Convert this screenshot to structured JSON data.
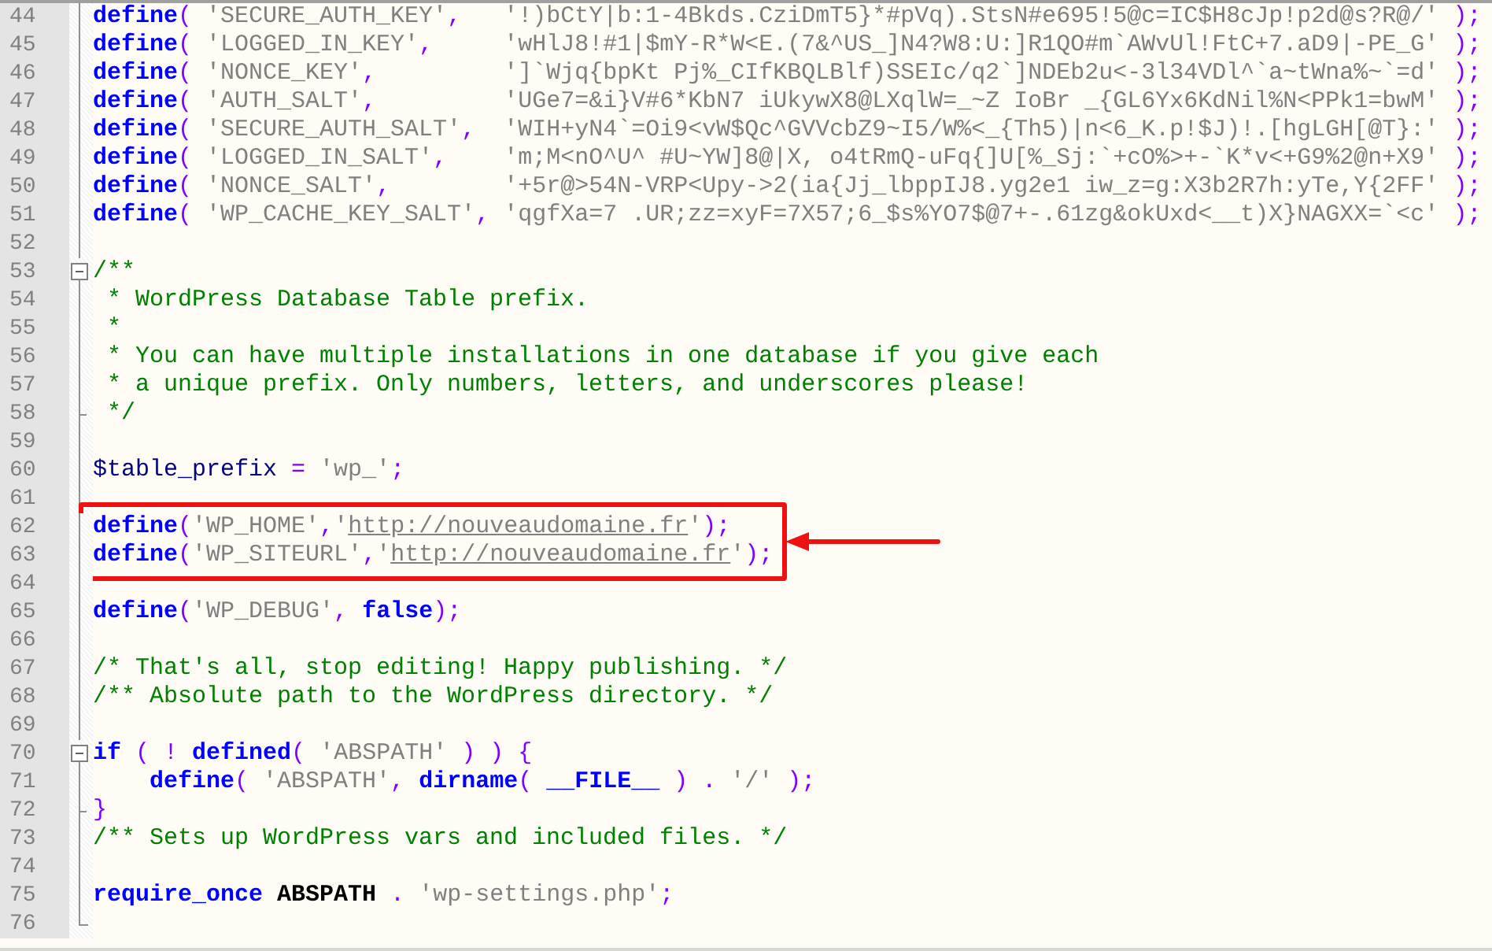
{
  "editor": {
    "lines": [
      {
        "number": "44",
        "kind": "line",
        "boxed": false,
        "tokens": [
          {
            "kind": "keyword",
            "text": "define"
          },
          {
            "kind": "operator",
            "text": "( "
          },
          {
            "kind": "string",
            "text": "'SECURE_AUTH_KEY'"
          },
          {
            "kind": "operator",
            "text": ",   "
          },
          {
            "kind": "string",
            "text": "'!)bCtY|b:1-4Bkds.CziDmT5}*#pVq).StsN#e695!5@c=IC$H8cJp!p2d@s?R@/'"
          },
          {
            "kind": "operator",
            "text": " );"
          }
        ]
      },
      {
        "number": "45",
        "kind": "line",
        "boxed": false,
        "tokens": [
          {
            "kind": "keyword",
            "text": "define"
          },
          {
            "kind": "operator",
            "text": "( "
          },
          {
            "kind": "string",
            "text": "'LOGGED_IN_KEY'"
          },
          {
            "kind": "operator",
            "text": ",     "
          },
          {
            "kind": "string",
            "text": "'wHlJ8!#1|$mY-R*W<E.(7&^US_]N4?W8:U:]R1QO#m`AWvUl!FtC+7.aD9|-PE_G'"
          },
          {
            "kind": "operator",
            "text": " );"
          }
        ]
      },
      {
        "number": "46",
        "kind": "line",
        "boxed": false,
        "tokens": [
          {
            "kind": "keyword",
            "text": "define"
          },
          {
            "kind": "operator",
            "text": "( "
          },
          {
            "kind": "string",
            "text": "'NONCE_KEY'"
          },
          {
            "kind": "operator",
            "text": ",         "
          },
          {
            "kind": "string",
            "text": "']`Wjq{bpKt Pj%_CIfKBQLBlf)SSEIc/q2`]NDEb2u<-3l34VDl^`a~tWna%~`=d'"
          },
          {
            "kind": "operator",
            "text": " );"
          }
        ]
      },
      {
        "number": "47",
        "kind": "line",
        "boxed": false,
        "tokens": [
          {
            "kind": "keyword",
            "text": "define"
          },
          {
            "kind": "operator",
            "text": "( "
          },
          {
            "kind": "string",
            "text": "'AUTH_SALT'"
          },
          {
            "kind": "operator",
            "text": ",         "
          },
          {
            "kind": "string",
            "text": "'UGe7=&i}V#6*KbN7 iUkywX8@LXqlW=_~Z IoBr _{GL6Yx6KdNil%N<PPk1=bwM'"
          },
          {
            "kind": "operator",
            "text": " );"
          }
        ]
      },
      {
        "number": "48",
        "kind": "line",
        "boxed": false,
        "tokens": [
          {
            "kind": "keyword",
            "text": "define"
          },
          {
            "kind": "operator",
            "text": "( "
          },
          {
            "kind": "string",
            "text": "'SECURE_AUTH_SALT'"
          },
          {
            "kind": "operator",
            "text": ",  "
          },
          {
            "kind": "string",
            "text": "'WIH+yN4`=Oi9<vW$Qc^GVVcbZ9~I5/W%<_{Th5)|n<6_K.p!$J)!.[hgLGH[@T}:'"
          },
          {
            "kind": "operator",
            "text": " );"
          }
        ]
      },
      {
        "number": "49",
        "kind": "line",
        "boxed": false,
        "tokens": [
          {
            "kind": "keyword",
            "text": "define"
          },
          {
            "kind": "operator",
            "text": "( "
          },
          {
            "kind": "string",
            "text": "'LOGGED_IN_SALT'"
          },
          {
            "kind": "operator",
            "text": ",    "
          },
          {
            "kind": "string",
            "text": "'m;M<nO^U^ #U~YW]8@|X, o4tRmQ-uFq{]U[%_Sj:`+cO%>+-`K*v<+G9%2@n+X9'"
          },
          {
            "kind": "operator",
            "text": " );"
          }
        ]
      },
      {
        "number": "50",
        "kind": "line",
        "boxed": false,
        "tokens": [
          {
            "kind": "keyword",
            "text": "define"
          },
          {
            "kind": "operator",
            "text": "( "
          },
          {
            "kind": "string",
            "text": "'NONCE_SALT'"
          },
          {
            "kind": "operator",
            "text": ",        "
          },
          {
            "kind": "string",
            "text": "'+5r@>54N-VRP<Upy->2(ia{Jj_lbppIJ8.yg2e1 iw_z=g:X3b2R7h:yTe,Y{2FF'"
          },
          {
            "kind": "operator",
            "text": " );"
          }
        ]
      },
      {
        "number": "51",
        "kind": "line",
        "boxed": false,
        "tokens": [
          {
            "kind": "keyword",
            "text": "define"
          },
          {
            "kind": "operator",
            "text": "( "
          },
          {
            "kind": "string",
            "text": "'WP_CACHE_KEY_SALT'"
          },
          {
            "kind": "operator",
            "text": ", "
          },
          {
            "kind": "string",
            "text": "'qgfXa=7 .UR;zz=xyF=7X57;6_$s%YO7$@7+-.61zg&okUxd<__t)X}NAGXX=`<c'"
          },
          {
            "kind": "operator",
            "text": " );"
          }
        ]
      },
      {
        "number": "52",
        "kind": "line",
        "boxed": false
      },
      {
        "number": "53",
        "kind": "open",
        "boxed": false,
        "tokens": [
          {
            "kind": "comment",
            "text": "/**"
          }
        ]
      },
      {
        "number": "54",
        "kind": "line",
        "boxed": false,
        "tokens": [
          {
            "kind": "comment",
            "text": " * WordPress Database Table prefix."
          }
        ]
      },
      {
        "number": "55",
        "kind": "line",
        "boxed": false,
        "tokens": [
          {
            "kind": "comment",
            "text": " *"
          }
        ]
      },
      {
        "number": "56",
        "kind": "line",
        "boxed": false,
        "tokens": [
          {
            "kind": "comment",
            "text": " * You can have multiple installations in one database if you give each"
          }
        ]
      },
      {
        "number": "57",
        "kind": "line",
        "boxed": false,
        "tokens": [
          {
            "kind": "comment",
            "text": " * a unique prefix. Only numbers, letters, and underscores please!"
          }
        ]
      },
      {
        "number": "58",
        "kind": "end",
        "boxed": false,
        "tokens": [
          {
            "kind": "comment",
            "text": " */"
          }
        ]
      },
      {
        "number": "59",
        "kind": "line",
        "boxed": false
      },
      {
        "number": "60",
        "kind": "line",
        "boxed": false,
        "tokens": [
          {
            "kind": "variable",
            "text": "$table_prefix"
          },
          {
            "kind": "operator",
            "text": " = "
          },
          {
            "kind": "string",
            "text": "'wp_'"
          },
          {
            "kind": "operator",
            "text": ";"
          }
        ]
      },
      {
        "number": "61",
        "kind": "line",
        "boxed": false
      },
      {
        "number": "62",
        "kind": "line",
        "boxed": true,
        "tokens": [
          {
            "kind": "keyword",
            "text": "define"
          },
          {
            "kind": "operator",
            "text": "("
          },
          {
            "kind": "string",
            "text": "'WP_HOME'"
          },
          {
            "kind": "operator",
            "text": ","
          },
          {
            "kind": "string",
            "text": "'"
          },
          {
            "kind": "link",
            "text": "http://nouveaudomaine.fr"
          },
          {
            "kind": "string",
            "text": "'"
          },
          {
            "kind": "operator",
            "text": ");"
          }
        ]
      },
      {
        "number": "63",
        "kind": "line",
        "boxed": true,
        "tokens": [
          {
            "kind": "keyword",
            "text": "define"
          },
          {
            "kind": "operator",
            "text": "("
          },
          {
            "kind": "string",
            "text": "'WP_SITEURL'"
          },
          {
            "kind": "operator",
            "text": ","
          },
          {
            "kind": "string",
            "text": "'"
          },
          {
            "kind": "link",
            "text": "http://nouveaudomaine.fr"
          },
          {
            "kind": "string",
            "text": "'"
          },
          {
            "kind": "operator",
            "text": ");"
          }
        ]
      },
      {
        "number": "64",
        "kind": "line",
        "boxed": false
      },
      {
        "number": "65",
        "kind": "line",
        "boxed": false,
        "tokens": [
          {
            "kind": "keyword",
            "text": "define"
          },
          {
            "kind": "operator",
            "text": "("
          },
          {
            "kind": "string",
            "text": "'WP_DEBUG'"
          },
          {
            "kind": "operator",
            "text": ", "
          },
          {
            "kind": "keyword",
            "text": "false"
          },
          {
            "kind": "operator",
            "text": ");"
          }
        ]
      },
      {
        "number": "66",
        "kind": "line",
        "boxed": false
      },
      {
        "number": "67",
        "kind": "line",
        "boxed": false,
        "tokens": [
          {
            "kind": "comment",
            "text": "/* That's all, stop editing! Happy publishing. */"
          }
        ]
      },
      {
        "number": "68",
        "kind": "line",
        "boxed": false,
        "tokens": [
          {
            "kind": "comment",
            "text": "/** Absolute path to the WordPress directory. */"
          }
        ]
      },
      {
        "number": "69",
        "kind": "line",
        "boxed": false
      },
      {
        "number": "70",
        "kind": "open",
        "boxed": false,
        "tokens": [
          {
            "kind": "keyword",
            "text": "if"
          },
          {
            "kind": "operator",
            "text": " ( ! "
          },
          {
            "kind": "keyword",
            "text": "defined"
          },
          {
            "kind": "operator",
            "text": "( "
          },
          {
            "kind": "string",
            "text": "'ABSPATH'"
          },
          {
            "kind": "operator",
            "text": " ) ) {"
          }
        ]
      },
      {
        "number": "71",
        "kind": "line",
        "boxed": false,
        "tokens": [
          {
            "kind": "keyword",
            "text": "    define"
          },
          {
            "kind": "operator",
            "text": "( "
          },
          {
            "kind": "string",
            "text": "'ABSPATH'"
          },
          {
            "kind": "operator",
            "text": ", "
          },
          {
            "kind": "keyword",
            "text": "dirname"
          },
          {
            "kind": "operator",
            "text": "( "
          },
          {
            "kind": "keyword",
            "text": "__FILE__"
          },
          {
            "kind": "operator",
            "text": " ) . "
          },
          {
            "kind": "string",
            "text": "'/'"
          },
          {
            "kind": "operator",
            "text": " );"
          }
        ]
      },
      {
        "number": "72",
        "kind": "end",
        "boxed": false,
        "tokens": [
          {
            "kind": "operator",
            "text": "}"
          }
        ]
      },
      {
        "number": "73",
        "kind": "line",
        "boxed": false,
        "tokens": [
          {
            "kind": "comment",
            "text": "/** Sets up WordPress vars and included files. */"
          }
        ]
      },
      {
        "number": "74",
        "kind": "line",
        "boxed": false
      },
      {
        "number": "75",
        "kind": "line",
        "boxed": false,
        "tokens": [
          {
            "kind": "keyword",
            "text": "require_once"
          },
          {
            "kind": "constant",
            "text": " ABSPATH"
          },
          {
            "kind": "operator",
            "text": " . "
          },
          {
            "kind": "string",
            "text": "'wp-settings.php'"
          },
          {
            "kind": "operator",
            "text": ";"
          }
        ]
      },
      {
        "number": "76",
        "kind": "last",
        "boxed": false
      }
    ]
  }
}
